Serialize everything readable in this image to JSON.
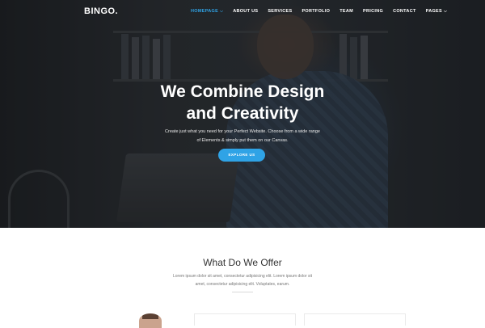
{
  "nav": {
    "logo": "BINGO.",
    "items": [
      {
        "label": "HOMEPAGE",
        "has_dropdown": true,
        "active": true
      },
      {
        "label": "ABOUT US",
        "has_dropdown": false,
        "active": false
      },
      {
        "label": "SERVICES",
        "has_dropdown": false,
        "active": false
      },
      {
        "label": "PORTFOLIO",
        "has_dropdown": false,
        "active": false
      },
      {
        "label": "TEAM",
        "has_dropdown": false,
        "active": false
      },
      {
        "label": "PRICING",
        "has_dropdown": false,
        "active": false
      },
      {
        "label": "CONTACT",
        "has_dropdown": false,
        "active": false
      },
      {
        "label": "PAGES",
        "has_dropdown": true,
        "active": false
      }
    ],
    "active_color": "#2fa3e6"
  },
  "hero": {
    "title_line1": "We Combine Design",
    "title_line2": "and Creativity",
    "subtitle_line1": "Create just what you need for your Perfect Website. Choose from a wide range",
    "subtitle_line2": "of Elements & simply put them on our Canvas.",
    "cta_label": "EXPLORE US",
    "cta_color": "#2fa3e6"
  },
  "offer": {
    "title": "What Do We Offer",
    "desc_line1": "Lorem ipsum dolor sit amet, consectetur adipisicing elit. Lorem ipsum dolor sit",
    "desc_line2": "amet, consectetur adipisicing elit. Voluptates, earum."
  }
}
